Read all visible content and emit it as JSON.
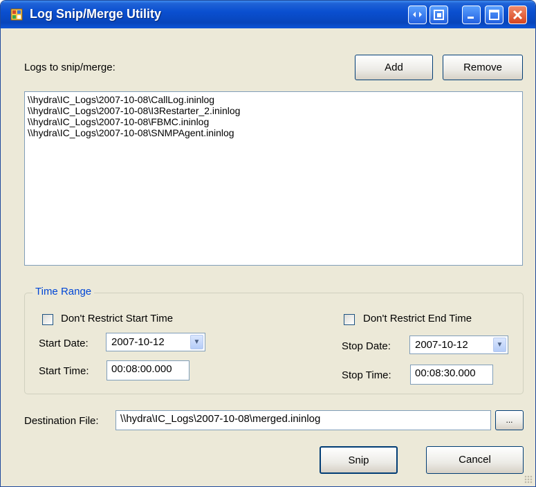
{
  "window": {
    "title": "Log Snip/Merge Utility",
    "title_buttons": [
      "extra-left-icon",
      "extra-right-icon",
      "minimize-icon",
      "maximize-icon",
      "close-icon"
    ]
  },
  "logs": {
    "label": "Logs to snip/merge:",
    "add_button": "Add",
    "remove_button": "Remove",
    "items": [
      "\\\\hydra\\IC_Logs\\2007-10-08\\CallLog.ininlog",
      "\\\\hydra\\IC_Logs\\2007-10-08\\I3Restarter_2.ininlog",
      "\\\\hydra\\IC_Logs\\2007-10-08\\FBMC.ininlog",
      "\\\\hydra\\IC_Logs\\2007-10-08\\SNMPAgent.ininlog"
    ]
  },
  "time_range": {
    "title": "Time Range",
    "start": {
      "restrict_label": "Don't Restrict Start Time",
      "date_label": "Start Date:",
      "date_value": "2007-10-12",
      "time_label": "Start Time:",
      "time_value": "00:08:00.000"
    },
    "end": {
      "restrict_label": "Don't Restrict End Time",
      "date_label": "Stop Date:",
      "date_value": "2007-10-12",
      "time_label": "Stop Time:",
      "time_value": "00:08:30.000"
    }
  },
  "destination": {
    "label": "Destination File:",
    "value": "\\\\hydra\\IC_Logs\\2007-10-08\\merged.ininlog",
    "browse_button": "..."
  },
  "footer": {
    "snip_button": "Snip",
    "cancel_button": "Cancel"
  },
  "colors": {
    "titlebar": "#0a4fd0",
    "window_bg": "#ece9d8",
    "group_title": "#0046d5",
    "border": "#7f9db9"
  }
}
